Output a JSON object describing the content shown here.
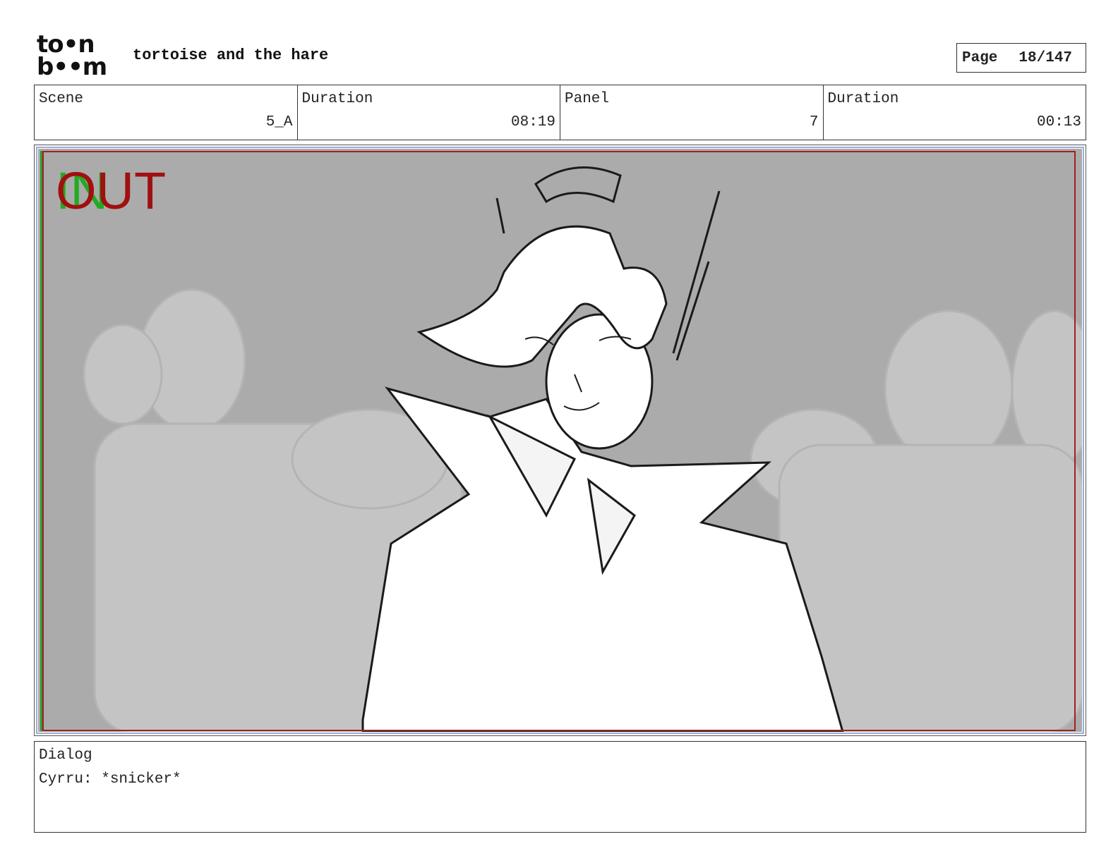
{
  "header": {
    "logo_text_top": "to•n",
    "logo_text_bottom": "b••m",
    "project_title": "tortoise and the hare",
    "page_label": "Page",
    "page_value": "18/147"
  },
  "info": {
    "scene_label": "Scene",
    "scene_value": "5_A",
    "scene_duration_label": "Duration",
    "scene_duration_value": "08:19",
    "panel_label": "Panel",
    "panel_value": "7",
    "panel_duration_label": "Duration",
    "panel_duration_value": "00:13"
  },
  "panel": {
    "in_marker": "IN",
    "out_marker": "OUT"
  },
  "dialog": {
    "label": "Dialog",
    "text": "Cyrru: *snicker*"
  },
  "colors": {
    "in_marker": "#22aa22",
    "out_marker": "#a01010",
    "safe_frame": "#a32020",
    "background_sketch": "#ababab"
  }
}
